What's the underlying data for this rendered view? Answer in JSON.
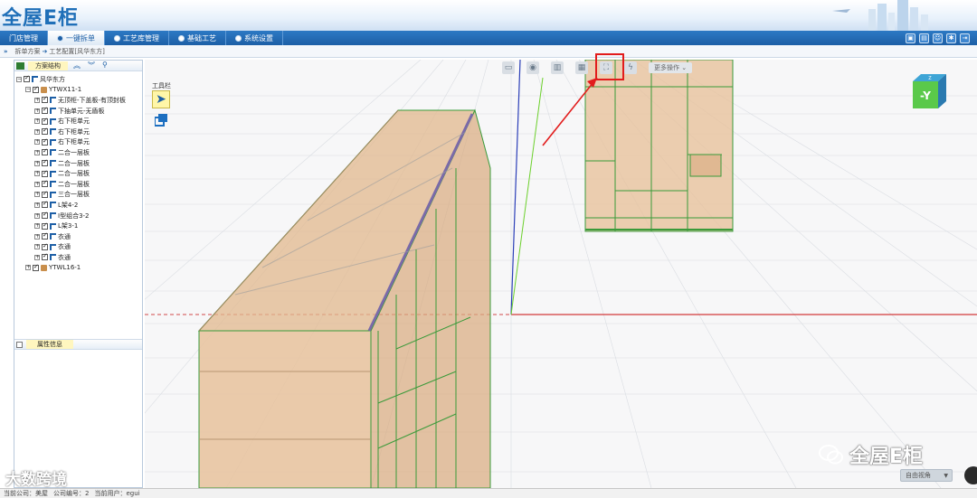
{
  "app": {
    "logo_text": "全屋E柜"
  },
  "nav": {
    "items": [
      {
        "label": "门店管理",
        "active": false
      },
      {
        "label": "一键拆单",
        "active": true
      },
      {
        "label": "工艺库管理",
        "active": false
      },
      {
        "label": "基础工艺",
        "active": false
      },
      {
        "label": "系统设置",
        "active": false
      }
    ],
    "right_icons": [
      "image-icon",
      "calendar-icon",
      "user-icon",
      "gear-icon",
      "exit-icon"
    ]
  },
  "breadcrumb": {
    "marker": "»",
    "part1": "拆单方案",
    "arrow": "➔",
    "part2": "工艺配置[风华东方]"
  },
  "left_panel": {
    "title": "方案结构",
    "tree": [
      {
        "level": 0,
        "label": "风华东方",
        "icon": "blue"
      },
      {
        "level": 1,
        "label": "YTWX11-1",
        "icon": "box"
      },
      {
        "level": 2,
        "label": "无顶柜-下盖板-有顶封板",
        "icon": "blue"
      },
      {
        "level": 2,
        "label": "下抽单元-无盾板",
        "icon": "blue"
      },
      {
        "level": 2,
        "label": "右下柜单元",
        "icon": "blue"
      },
      {
        "level": 2,
        "label": "右下柜单元",
        "icon": "blue"
      },
      {
        "level": 2,
        "label": "右下柜单元",
        "icon": "blue"
      },
      {
        "level": 2,
        "label": "二合一层板",
        "icon": "blue"
      },
      {
        "level": 2,
        "label": "二合一层板",
        "icon": "blue"
      },
      {
        "level": 2,
        "label": "二合一层板",
        "icon": "blue"
      },
      {
        "level": 2,
        "label": "二合一层板",
        "icon": "blue"
      },
      {
        "level": 2,
        "label": "三合一层板",
        "icon": "blue"
      },
      {
        "level": 2,
        "label": "L架4-2",
        "icon": "blue"
      },
      {
        "level": 2,
        "label": "I型组合3-2",
        "icon": "blue"
      },
      {
        "level": 2,
        "label": "L架3-1",
        "icon": "blue"
      },
      {
        "level": 2,
        "label": "衣通",
        "icon": "blue"
      },
      {
        "level": 2,
        "label": "衣通",
        "icon": "blue"
      },
      {
        "level": 2,
        "label": "衣通",
        "icon": "blue"
      },
      {
        "level": 1,
        "label": "YTWL16-1",
        "icon": "box"
      }
    ],
    "props_title": "属性信息"
  },
  "viewport": {
    "toolbox_label": "工具栏",
    "toolbar_more": "更多操作",
    "cube_label": "-Y",
    "view_mode": "自由视角"
  },
  "watermark": {
    "text": "全屋E柜",
    "source": "大数跨境"
  },
  "status": {
    "company_label": "当前公司：",
    "company": "美屋",
    "code_label": "公司编号：",
    "code": "2",
    "user_label": "当前用户：",
    "user": "egui"
  }
}
